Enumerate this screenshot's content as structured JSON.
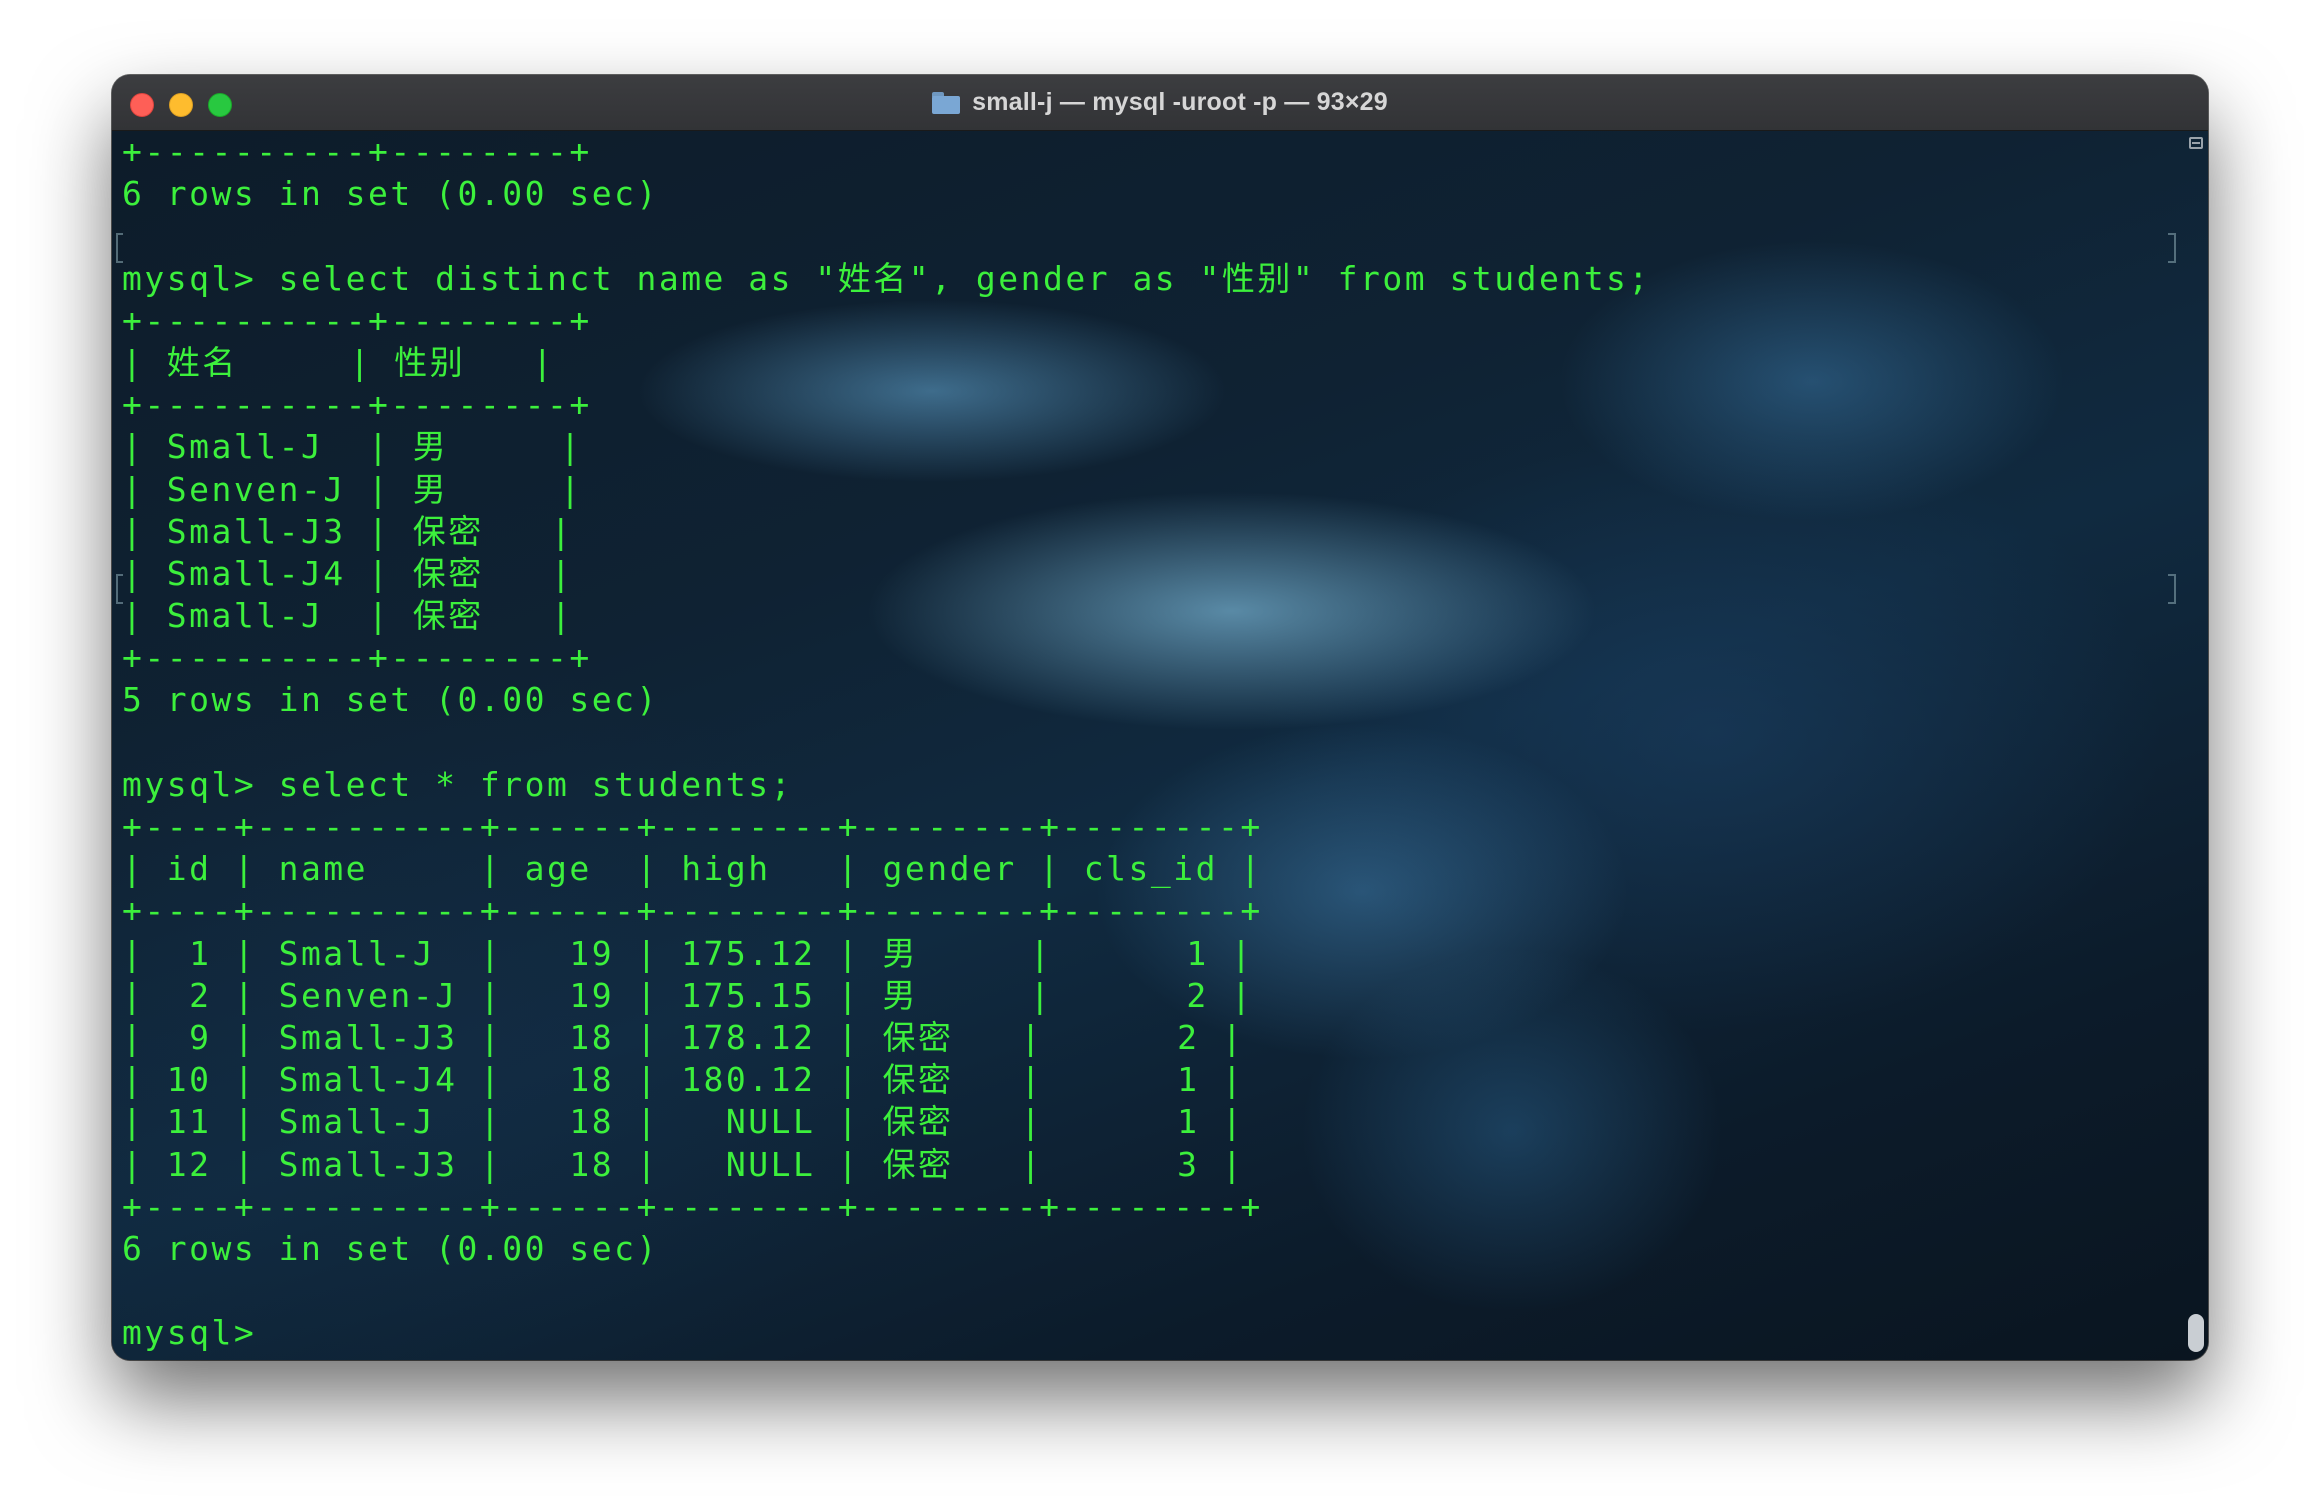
{
  "window": {
    "title": "small-j — mysql -uroot -p — 93×29",
    "title_icon": "folder-icon"
  },
  "terminal": {
    "lines": [
      "+----------+--------+",
      "6 rows in set (0.00 sec)",
      "",
      "mysql> select distinct name as \"姓名\", gender as \"性别\" from students;",
      "+----------+--------+",
      "| 姓名     | 性别   |",
      "+----------+--------+",
      "| Small-J  | 男     |",
      "| Senven-J | 男     |",
      "| Small-J3 | 保密   |",
      "| Small-J4 | 保密   |",
      "| Small-J  | 保密   |",
      "+----------+--------+",
      "5 rows in set (0.00 sec)",
      "",
      "mysql> select * from students;",
      "+----+----------+------+--------+--------+--------+",
      "| id | name     | age  | high   | gender | cls_id |",
      "+----+----------+------+--------+--------+--------+",
      "|  1 | Small-J  |   19 | 175.12 | 男     |      1 |",
      "|  2 | Senven-J |   19 | 175.15 | 男     |      2 |",
      "|  9 | Small-J3 |   18 | 178.12 | 保密   |      2 |",
      "| 10 | Small-J4 |   18 | 180.12 | 保密   |      1 |",
      "| 11 | Small-J  |   18 |   NULL | 保密   |      1 |",
      "| 12 | Small-J3 |   18 |   NULL | 保密   |      3 |",
      "+----+----------+------+--------+--------+--------+",
      "6 rows in set (0.00 sec)",
      "",
      "mysql> "
    ]
  },
  "colors": {
    "terminal_text": "#3cf03c",
    "close": "#fe5f57",
    "minimize": "#febc2e",
    "maximize": "#28c840"
  }
}
